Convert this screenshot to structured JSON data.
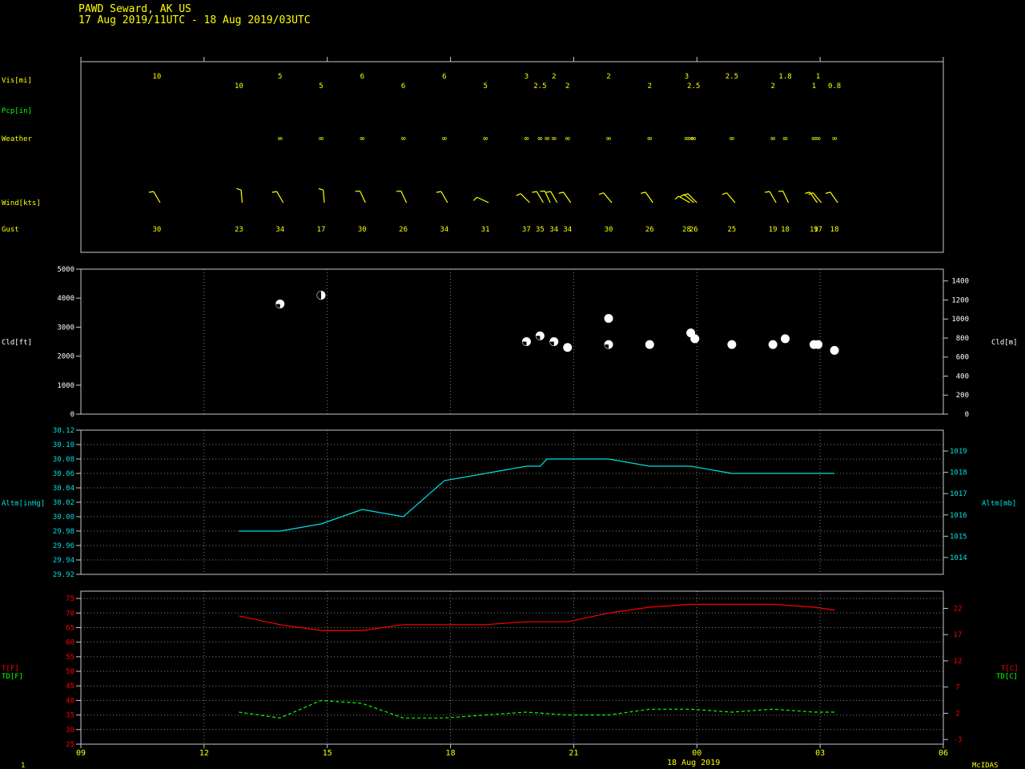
{
  "header": {
    "station": "PAWD  Seward, AK US",
    "period": "17 Aug 2019/11UTC - 18 Aug 2019/03UTC"
  },
  "footer": {
    "page_num": "1",
    "date_label": "18 Aug 2019",
    "software": "McIDAS"
  },
  "colors": {
    "background": "#000000",
    "frame": "#c8c8c8",
    "grid": "#808080",
    "label_yellow": "#ffff00",
    "pcp_green": "#00ff00",
    "altimeter_cyan": "#00e0e0",
    "temp_red": "#ff0000",
    "dewpoint_green": "#00ff00",
    "cloud_white": "#ffffff"
  },
  "chart_data": [
    {
      "type": "table",
      "name": "surface observations",
      "row_labels": {
        "vis": "Vis[mi]",
        "pcp": "Pcp[in]",
        "weather": "Weather",
        "wind": "Wind[kts]",
        "gust": "Gust"
      },
      "time_axis": {
        "start_hour": 9,
        "end_hour": 30
      },
      "weather_symbol": "∞",
      "observations": [
        {
          "hour": 10.85,
          "vis": "10",
          "vis_row": 0,
          "wx": "",
          "wind_dir": 330,
          "wind_kt": 10,
          "gust": "30"
        },
        {
          "hour": 12.85,
          "vis": "10",
          "vis_row": 1,
          "wx": "",
          "wind_dir": 355,
          "wind_kt": 10,
          "gust": "23"
        },
        {
          "hour": 13.85,
          "vis": "5",
          "vis_row": 0,
          "wx": "∞",
          "wind_dir": 330,
          "wind_kt": 10,
          "gust": "34"
        },
        {
          "hour": 14.85,
          "vis": "5",
          "vis_row": 1,
          "wx": "∞",
          "wind_dir": 355,
          "wind_kt": 10,
          "gust": "17"
        },
        {
          "hour": 15.85,
          "vis": "6",
          "vis_row": 0,
          "wx": "∞",
          "wind_dir": 335,
          "wind_kt": 10,
          "gust": "30"
        },
        {
          "hour": 16.85,
          "vis": "6",
          "vis_row": 1,
          "wx": "∞",
          "wind_dir": 335,
          "wind_kt": 10,
          "gust": "26"
        },
        {
          "hour": 17.85,
          "vis": "6",
          "vis_row": 0,
          "wx": "∞",
          "wind_dir": 330,
          "wind_kt": 10,
          "gust": "34"
        },
        {
          "hour": 18.85,
          "vis": "5",
          "vis_row": 1,
          "wx": "∞",
          "wind_dir": 295,
          "wind_kt": 10,
          "gust": "31"
        },
        {
          "hour": 19.85,
          "vis": "3",
          "vis_row": 0,
          "wx": "∞",
          "wind_dir": 315,
          "wind_kt": 10,
          "gust": "37"
        },
        {
          "hour": 20.18,
          "vis": "2.5",
          "vis_row": 1,
          "wx": "∞",
          "wind_dir": 330,
          "wind_kt": 10,
          "gust": "35"
        },
        {
          "hour": 20.35,
          "vis": "",
          "vis_row": 1,
          "wx": "∞",
          "wind_dir": 335,
          "wind_kt": 10,
          "gust": ""
        },
        {
          "hour": 20.52,
          "vis": "2",
          "vis_row": 0,
          "wx": "∞",
          "wind_dir": 330,
          "wind_kt": 10,
          "gust": "34"
        },
        {
          "hour": 20.85,
          "vis": "2",
          "vis_row": 1,
          "wx": "∞",
          "wind_dir": 325,
          "wind_kt": 10,
          "gust": "34"
        },
        {
          "hour": 21.85,
          "vis": "2",
          "vis_row": 0,
          "wx": "∞",
          "wind_dir": 320,
          "wind_kt": 10,
          "gust": "30"
        },
        {
          "hour": 22.85,
          "vis": "2",
          "vis_row": 1,
          "wx": "∞",
          "wind_dir": 325,
          "wind_kt": 10,
          "gust": "26"
        },
        {
          "hour": 23.75,
          "vis": "3",
          "vis_row": 0,
          "wx": "∞",
          "wind_dir": 300,
          "wind_kt": 10,
          "gust": "28"
        },
        {
          "hour": 23.85,
          "vis": "",
          "vis_row": 0,
          "wx": "∞",
          "wind_dir": 310,
          "wind_kt": 10,
          "gust": ""
        },
        {
          "hour": 23.92,
          "vis": "2.5",
          "vis_row": 1,
          "wx": "∞",
          "wind_dir": 315,
          "wind_kt": 10,
          "gust": "26"
        },
        {
          "hour": 24.85,
          "vis": "2.5",
          "vis_row": 0,
          "wx": "∞",
          "wind_dir": 320,
          "wind_kt": 10,
          "gust": "25"
        },
        {
          "hour": 25.85,
          "vis": "2",
          "vis_row": 1,
          "wx": "∞",
          "wind_dir": 330,
          "wind_kt": 10,
          "gust": "19"
        },
        {
          "hour": 26.15,
          "vis": "1.8",
          "vis_row": 0,
          "wx": "∞",
          "wind_dir": 335,
          "wind_kt": 10,
          "gust": "18"
        },
        {
          "hour": 26.85,
          "vis": "1",
          "vis_row": 1,
          "wx": "∞",
          "wind_dir": 325,
          "wind_kt": 10,
          "gust": "19"
        },
        {
          "hour": 26.95,
          "vis": "1",
          "vis_row": 0,
          "wx": "∞",
          "wind_dir": 320,
          "wind_kt": 10,
          "gust": "17"
        },
        {
          "hour": 27.35,
          "vis": "0.8",
          "vis_row": 1,
          "wx": "∞",
          "wind_dir": 325,
          "wind_kt": 10,
          "gust": "18"
        }
      ]
    },
    {
      "type": "scatter",
      "name": "cloud base",
      "ylabel_left": "Cld[ft]",
      "ylabel_right": "Cld[m]",
      "ylim": [
        0,
        5000
      ],
      "yticks_left": [
        0,
        1000,
        2000,
        3000,
        4000,
        5000
      ],
      "yticks_right": [
        0,
        200,
        400,
        600,
        800,
        1000,
        1200,
        1400
      ],
      "points": [
        {
          "hour": 13.85,
          "ft": 3800,
          "cover": "broken"
        },
        {
          "hour": 14.85,
          "ft": 4100,
          "cover": "scattered"
        },
        {
          "hour": 19.85,
          "ft": 2500,
          "cover": "broken"
        },
        {
          "hour": 20.18,
          "ft": 2700,
          "cover": "broken"
        },
        {
          "hour": 20.52,
          "ft": 2500,
          "cover": "broken"
        },
        {
          "hour": 20.85,
          "ft": 2300,
          "cover": "overcast"
        },
        {
          "hour": 21.85,
          "ft": 2400,
          "cover": "broken"
        },
        {
          "hour": 21.85,
          "ft": 3300,
          "cover": "overcast"
        },
        {
          "hour": 22.85,
          "ft": 2400,
          "cover": "overcast"
        },
        {
          "hour": 23.85,
          "ft": 2800,
          "cover": "overcast"
        },
        {
          "hour": 23.95,
          "ft": 2600,
          "cover": "overcast"
        },
        {
          "hour": 24.85,
          "ft": 2400,
          "cover": "overcast"
        },
        {
          "hour": 25.85,
          "ft": 2400,
          "cover": "overcast"
        },
        {
          "hour": 26.15,
          "ft": 2600,
          "cover": "overcast"
        },
        {
          "hour": 26.85,
          "ft": 2400,
          "cover": "overcast"
        },
        {
          "hour": 26.95,
          "ft": 2400,
          "cover": "overcast"
        },
        {
          "hour": 27.35,
          "ft": 2200,
          "cover": "overcast"
        }
      ]
    },
    {
      "type": "line",
      "name": "altimeter",
      "ylabel_left": "Altm[inHg]",
      "ylabel_right": "Altm[mb]",
      "ylim": [
        29.92,
        30.12
      ],
      "yticks_left": [
        "29.92",
        "29.94",
        "29.96",
        "29.98",
        "30.00",
        "30.02",
        "30.04",
        "30.06",
        "30.08",
        "30.10",
        "30.12"
      ],
      "yticks_right": [
        1014,
        1015,
        1016,
        1017,
        1018,
        1019
      ],
      "x": [
        12.85,
        13.85,
        14.85,
        15.85,
        16.85,
        17.85,
        18.85,
        19.85,
        20.18,
        20.35,
        20.52,
        20.85,
        21.85,
        22.85,
        23.85,
        24.85,
        25.85,
        26.85,
        27.35
      ],
      "y": [
        29.98,
        29.98,
        29.99,
        30.01,
        30.0,
        30.05,
        30.06,
        30.07,
        30.07,
        30.08,
        30.08,
        30.08,
        30.08,
        30.07,
        30.07,
        30.06,
        30.06,
        30.06,
        30.06
      ]
    },
    {
      "type": "line",
      "name": "temperature",
      "ylabel_left": [
        "T[F]",
        "TD[F]"
      ],
      "ylabel_right": [
        "T[C]",
        "TD[C]"
      ],
      "ylim": [
        25,
        77.5
      ],
      "yticks_left": [
        25,
        30,
        35,
        40,
        45,
        50,
        55,
        60,
        65,
        70,
        75
      ],
      "yticks_right": [
        -3,
        2,
        7,
        12,
        17,
        22
      ],
      "xticks": [
        "09",
        "12",
        "15",
        "18",
        "21",
        "00",
        "03",
        "06"
      ],
      "series": [
        {
          "name": "T",
          "x": [
            12.85,
            13.85,
            14.85,
            15.85,
            16.85,
            17.85,
            18.85,
            19.85,
            20.85,
            21.85,
            22.85,
            23.85,
            24.85,
            25.85,
            26.85,
            27.35
          ],
          "y": [
            69,
            66,
            64,
            64,
            66,
            66,
            66,
            67,
            67,
            70,
            72,
            73,
            73,
            73,
            72,
            71
          ]
        },
        {
          "name": "TD",
          "x": [
            12.85,
            13.85,
            14.85,
            15.85,
            16.85,
            17.85,
            18.85,
            19.85,
            20.85,
            21.85,
            22.85,
            23.85,
            24.85,
            25.85,
            26.85,
            27.35
          ],
          "y": [
            36,
            34,
            40,
            39,
            34,
            34,
            35,
            36,
            35,
            35,
            37,
            37,
            36,
            37,
            36,
            36
          ]
        }
      ]
    }
  ]
}
